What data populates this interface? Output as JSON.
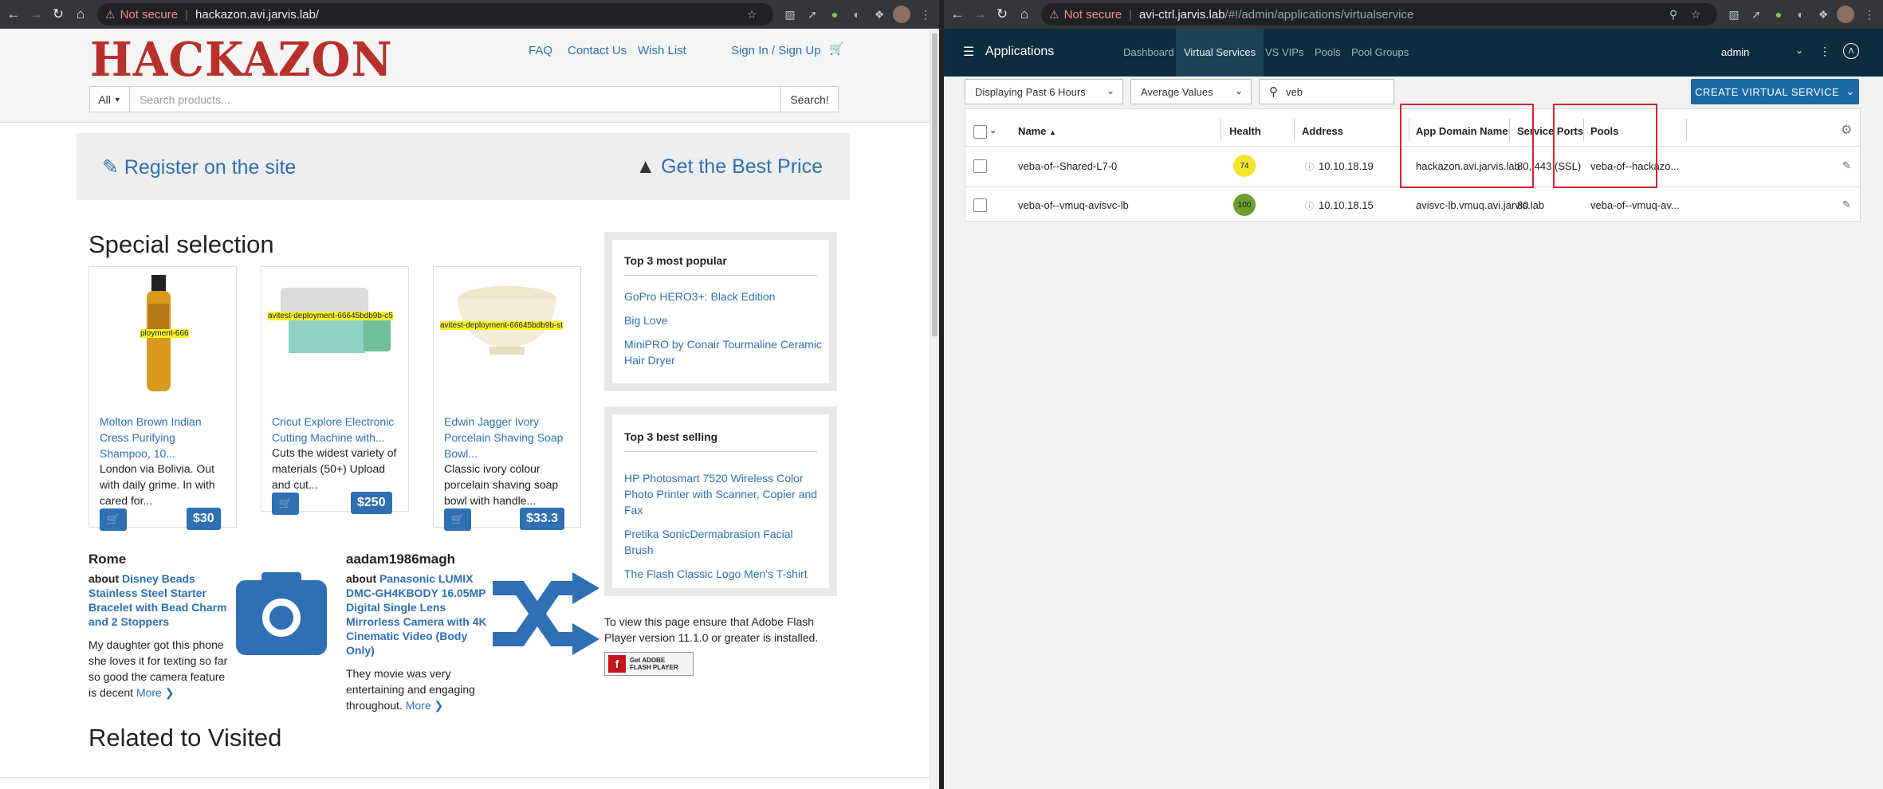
{
  "left": {
    "url_warning": "Not secure",
    "url_host": "hackazon.avi.jarvis.lab/",
    "logo_text": "HACKAZON",
    "nav": {
      "faq": "FAQ",
      "contact": "Contact Us",
      "wishlist": "Wish List",
      "signin": "Sign In / Sign Up"
    },
    "search": {
      "category": "All",
      "placeholder": "Search products...",
      "button": "Search!"
    },
    "promo": {
      "register": "Register on the site",
      "best_price": "Get the Best Price"
    },
    "special_title": "Special selection",
    "products": [
      {
        "title": "Molton Brown Indian Cress Purifying Shampoo, 10...",
        "desc": "London via Bolivia. Out with daily grime. In with cared for...",
        "price": "$30",
        "tag": "ployment-666"
      },
      {
        "title": "Cricut Explore Electronic Cutting Machine with...",
        "desc": "Cuts the widest variety of materials (50+) Upload and cut...",
        "price": "$250",
        "tag": "avitest-deployment-66645bdb9b-c5"
      },
      {
        "title": "Edwin Jagger Ivory Porcelain Shaving Soap Bowl...",
        "desc": "Classic ivory colour porcelain shaving soap bowl with handle...",
        "price": "$33.3",
        "tag": "avitest-deployment-66645bdb9b-st"
      }
    ],
    "popular": {
      "title": "Top 3 most popular",
      "items": [
        "GoPro HERO3+: Black Edition",
        "Big Love",
        "MiniPRO by Conair Tourmaline Ceramic Hair Dryer"
      ]
    },
    "bestselling": {
      "title": "Top 3 best selling",
      "items": [
        "HP Photosmart 7520 Wireless Color Photo Printer with Scanner, Copier and Fax",
        "Pretika SonicDermabrasion Facial Brush",
        "The Flash Classic Logo Men's T-shirt"
      ]
    },
    "flash_note": "To view this page ensure that Adobe Flash Player version 11.1.0 or greater is installed.",
    "flash_badge": "Get ADOBE FLASH PLAYER",
    "reviews": [
      {
        "name": "Rome",
        "about": "about",
        "product": "Disney Beads Stainless Steel Starter Bracelet with Bead Charm and 2 Stoppers",
        "text": "My daughter got this phone she loves it for texting so far so good the camera feature is decent",
        "more": "More"
      },
      {
        "name": "aadam1986magh",
        "about": "about",
        "product": "Panasonic LUMIX DMC-GH4KBODY 16.05MP Digital Single Lens Mirrorless Camera with 4K Cinematic Video (Body Only)",
        "text": "They movie was very entertaining and engaging throughout.",
        "more": "More"
      }
    ],
    "related_title": "Related to Visited"
  },
  "right": {
    "url_warning": "Not secure",
    "url_host": "avi-ctrl.jarvis.lab",
    "url_path": "/#!/admin/applications/virtualservice",
    "app_title": "Applications",
    "tabs": [
      "Dashboard",
      "Virtual Services",
      "VS VIPs",
      "Pools",
      "Pool Groups"
    ],
    "active_tab": "Virtual Services",
    "user": "admin",
    "time_filter": "Displaying Past 6 Hours",
    "value_filter": "Average Values",
    "search_value": "veb",
    "create_button": "CREATE VIRTUAL SERVICE",
    "columns": [
      "Name",
      "Health",
      "Address",
      "App Domain Name",
      "Service Ports",
      "Pools"
    ],
    "rows": [
      {
        "name": "veba-of--Shared-L7-0",
        "health": "74",
        "health_color": "#f2e52a",
        "address": "10.10.18.19",
        "domain": "hackazon.avi.jarvis.lab",
        "ports": "80, 443 (SSL)",
        "pools": "veba-of--hackazo..."
      },
      {
        "name": "veba-of--vmuq-avisvc-lb",
        "health": "100",
        "health_color": "#6f9e2c",
        "address": "10.10.18.15",
        "domain": "avisvc-lb.vmuq.avi.jarvis.lab",
        "ports": "80",
        "pools": "veba-of--vmuq-av..."
      }
    ]
  }
}
